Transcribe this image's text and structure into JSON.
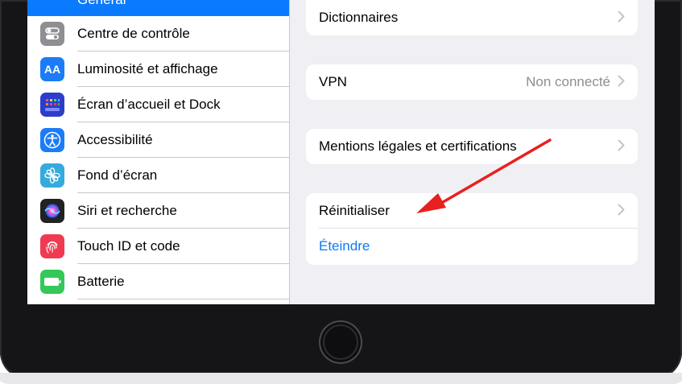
{
  "sidebar": {
    "active_item": "Général",
    "items": [
      {
        "label": "Centre de contrôle",
        "icon": "switches-icon",
        "color": "#8e8e93"
      },
      {
        "label": "Luminosité et affichage",
        "icon": "text-size-icon",
        "color": "#1c7cf6",
        "glyph": "AA"
      },
      {
        "label": "Écran d’accueil et Dock",
        "icon": "grid-icon",
        "color": "#2c3ec9"
      },
      {
        "label": "Accessibilité",
        "icon": "accessibility-icon",
        "color": "#1c7cf6"
      },
      {
        "label": "Fond d’écran",
        "icon": "flower-icon",
        "color": "#35aadc"
      },
      {
        "label": "Siri et recherche",
        "icon": "siri-icon",
        "color": "#222222"
      },
      {
        "label": "Touch ID et code",
        "icon": "fingerprint-icon",
        "color": "#f03a52"
      },
      {
        "label": "Batterie",
        "icon": "battery-icon",
        "color": "#34c759"
      }
    ]
  },
  "detail": {
    "dictionnaires": "Dictionnaires",
    "vpn": {
      "label": "VPN",
      "value": "Non connecté"
    },
    "mentions": "Mentions légales et certifications",
    "reinitialiser": "Réinitialiser",
    "eteindre": "Éteindre"
  },
  "colors": {
    "accent": "#0a7aff",
    "arrow": "#e8201e"
  }
}
